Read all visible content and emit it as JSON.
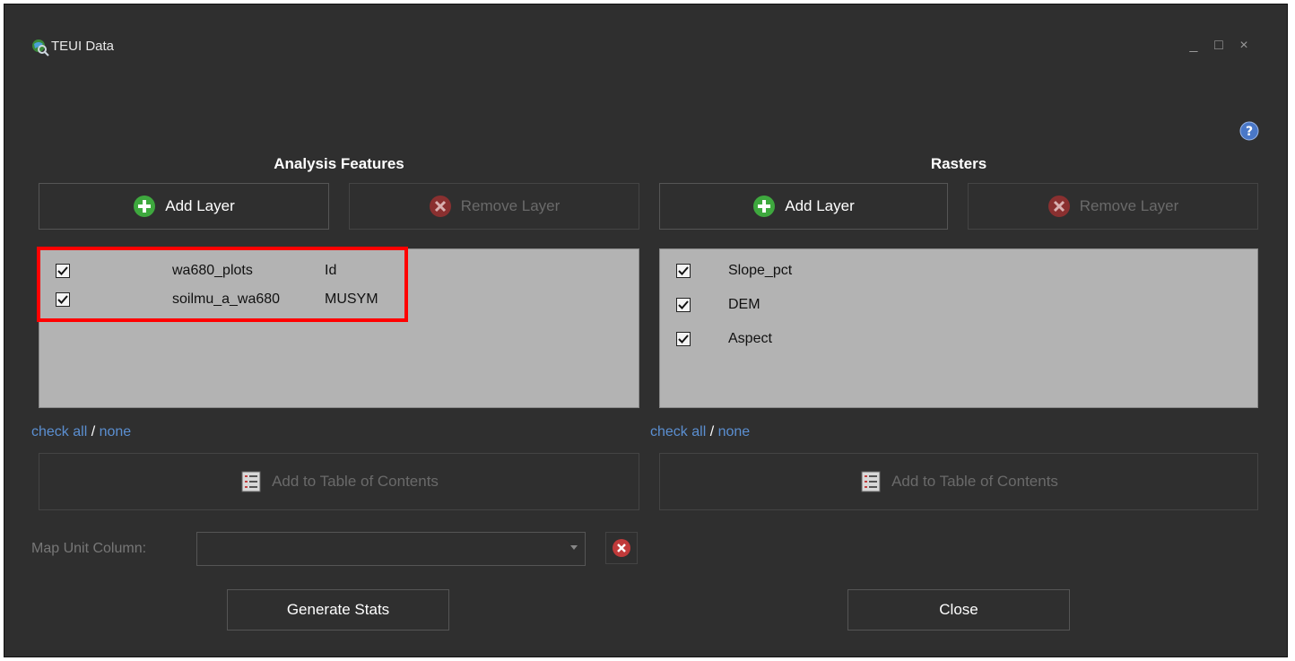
{
  "window": {
    "title": "TEUI Data",
    "controls": [
      "_",
      "□",
      "×"
    ]
  },
  "left": {
    "title": "Analysis Features",
    "add_label": "Add Layer",
    "remove_label": "Remove Layer",
    "items": [
      {
        "checked": true,
        "name": "wa680_plots",
        "field": "Id"
      },
      {
        "checked": true,
        "name": "soilmu_a_wa680",
        "field": "MUSYM"
      }
    ],
    "check_all": "check all",
    "separator": "/",
    "none": "none",
    "toc_label": "Add to Table of Contents"
  },
  "right": {
    "title": "Rasters",
    "add_label": "Add Layer",
    "remove_label": "Remove Layer",
    "items": [
      {
        "checked": true,
        "name": "Slope_pct"
      },
      {
        "checked": true,
        "name": "DEM"
      },
      {
        "checked": true,
        "name": "Aspect"
      }
    ],
    "check_all": "check all",
    "separator": "/",
    "none": "none",
    "toc_label": "Add to Table of Contents"
  },
  "map_unit": {
    "label": "Map Unit Column:",
    "value": ""
  },
  "buttons": {
    "generate": "Generate Stats",
    "close": "Close"
  },
  "colors": {
    "background": "#2f2f2f",
    "list_bg": "#b3b3b3",
    "link": "#5b8fd1",
    "highlight": "#ff0000"
  }
}
